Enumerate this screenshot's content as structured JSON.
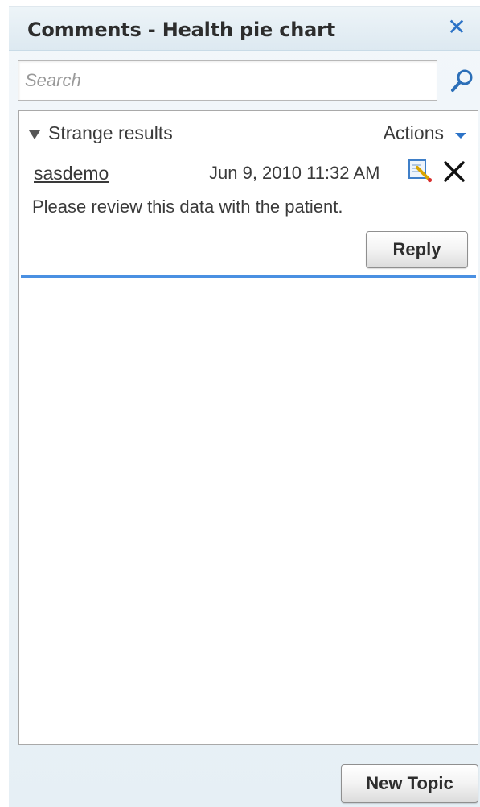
{
  "panel": {
    "title": "Comments - Health pie chart",
    "close_glyph": "✕"
  },
  "search": {
    "placeholder": "Search",
    "value": "",
    "icon": "search-icon"
  },
  "topic": {
    "title": "Strange results",
    "actions_label": "Actions",
    "comments": [
      {
        "author": "sasdemo",
        "timestamp": "Jun 9, 2010 11:32 AM",
        "text": "Please review this data with the patient.",
        "edit_icon": "edit-icon",
        "delete_icon": "delete-icon"
      }
    ],
    "reply_label": "Reply"
  },
  "footer": {
    "new_topic_label": "New Topic"
  },
  "colors": {
    "accent": "#2c73c7",
    "divider": "#4a90e2"
  }
}
